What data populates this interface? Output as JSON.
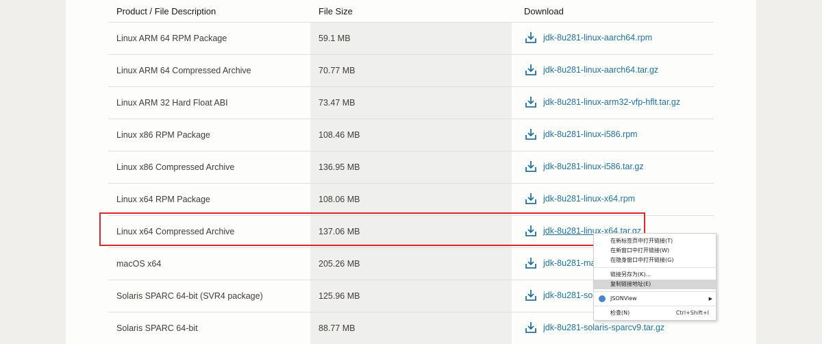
{
  "table": {
    "headers": [
      "Product / File Description",
      "File Size",
      "Download"
    ],
    "rows": [
      {
        "description": "Linux ARM 64 RPM Package",
        "size": "59.1 MB",
        "file": "jdk-8u281-linux-aarch64.rpm"
      },
      {
        "description": "Linux ARM 64 Compressed Archive",
        "size": "70.77 MB",
        "file": "jdk-8u281-linux-aarch64.tar.gz"
      },
      {
        "description": "Linux ARM 32 Hard Float ABI",
        "size": "73.47 MB",
        "file": "jdk-8u281-linux-arm32-vfp-hflt.tar.gz"
      },
      {
        "description": "Linux x86 RPM Package",
        "size": "108.46 MB",
        "file": "jdk-8u281-linux-i586.rpm"
      },
      {
        "description": "Linux x86 Compressed Archive",
        "size": "136.95 MB",
        "file": "jdk-8u281-linux-i586.tar.gz"
      },
      {
        "description": "Linux x64 RPM Package",
        "size": "108.06 MB",
        "file": "jdk-8u281-linux-x64.rpm"
      },
      {
        "description": "Linux x64 Compressed Archive",
        "size": "137.06 MB",
        "file": "jdk-8u281-linux-x64.tar.gz"
      },
      {
        "description": "macOS x64",
        "size": "205.26 MB",
        "file": "jdk-8u281-mac"
      },
      {
        "description": "Solaris SPARC 64-bit (SVR4 package)",
        "size": "125.96 MB",
        "file": "jdk-8u281-sola"
      },
      {
        "description": "Solaris SPARC 64-bit",
        "size": "88.77 MB",
        "file": "jdk-8u281-solaris-sparcv9.tar.gz"
      }
    ]
  },
  "context_menu": {
    "items": [
      {
        "label": "在新标签页中打开链接(T)"
      },
      {
        "label": "在新窗口中打开链接(W)"
      },
      {
        "label": "在隐身窗口中打开链接(G)"
      },
      {
        "label": "链接另存为(K)..."
      },
      {
        "label": "复制链接地址(E)"
      },
      {
        "label": "JSONView"
      },
      {
        "label": "检查(N)",
        "shortcut": "Ctrl+Shift+I"
      }
    ]
  },
  "colors": {
    "link": "#247197",
    "highlight_border": "#d9262c",
    "size_column_bg": "#efefed"
  },
  "icons": {
    "download": "download-icon",
    "jsonview": "jsonview-icon",
    "submenu": "submenu-arrow-icon"
  }
}
